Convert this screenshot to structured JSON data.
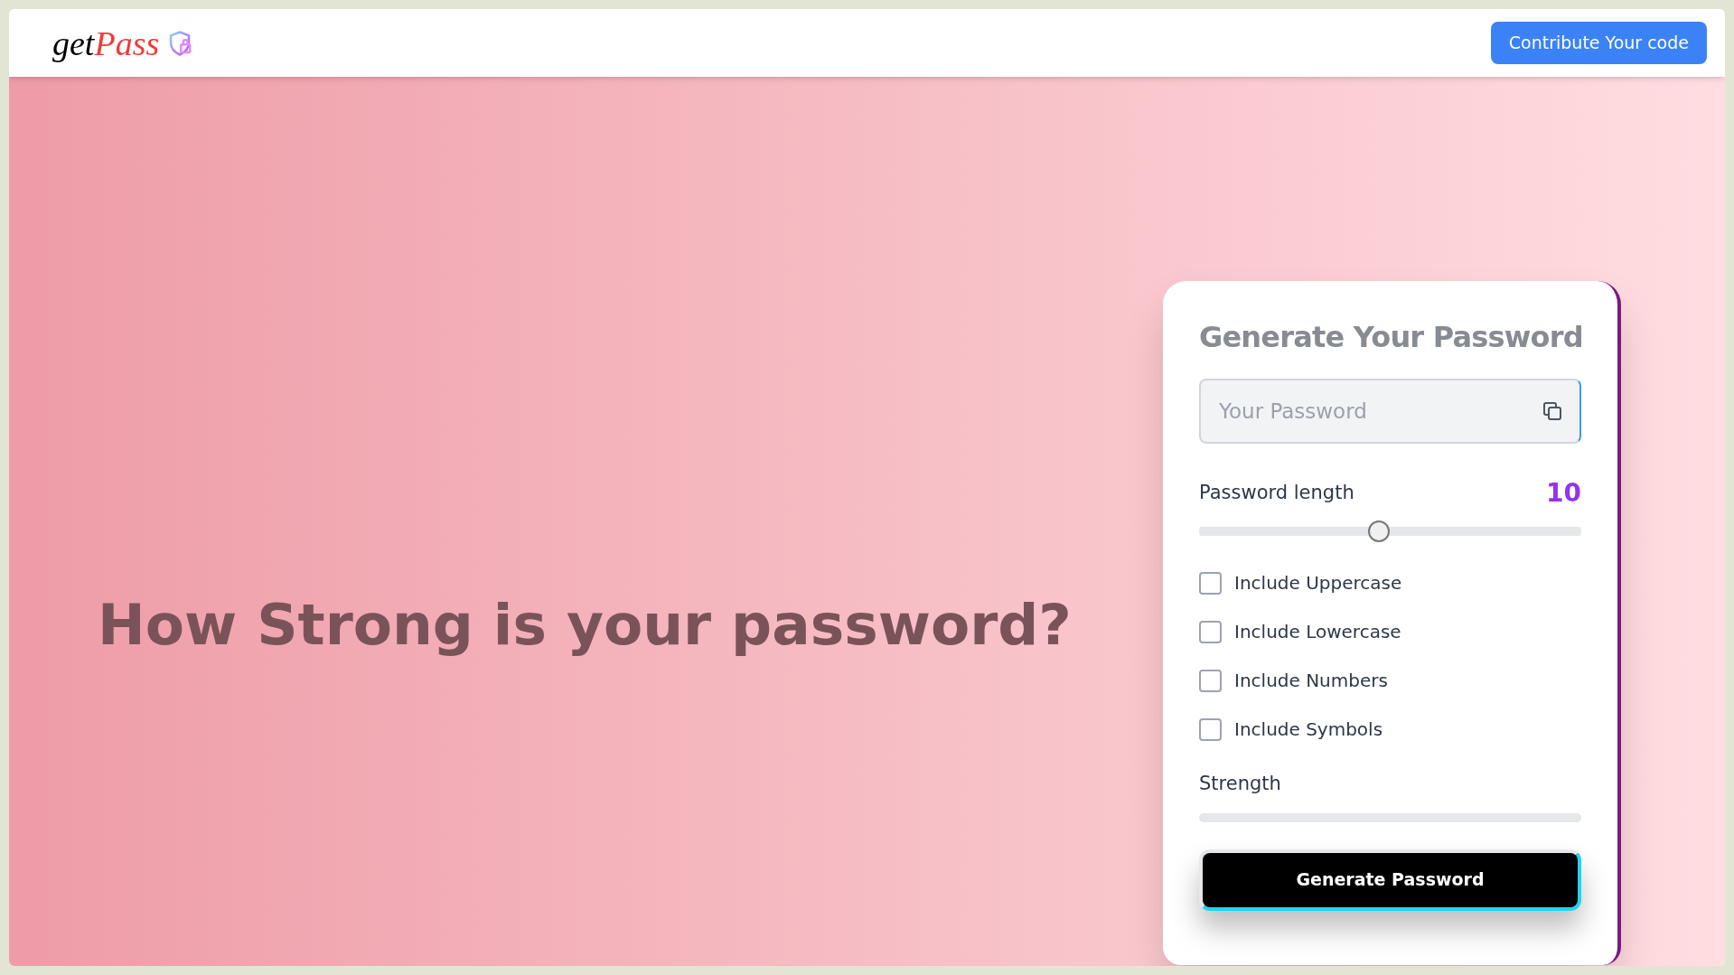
{
  "navbar": {
    "logo": {
      "prefix": "get",
      "suffix": "Pass"
    },
    "button": "Contribute Your code"
  },
  "hero": {
    "headline": "How Strong is your password?"
  },
  "generator": {
    "title": "Generate Your Password",
    "password_field": {
      "placeholder": "Your Password"
    },
    "length": {
      "label": "Password length",
      "value": "10",
      "level": 0.47
    },
    "options": [
      {
        "label": "Include Uppercase",
        "checked": false
      },
      {
        "label": "Include Lowercase",
        "checked": false
      },
      {
        "label": "Include Numbers",
        "checked": false
      },
      {
        "label": "Include Symbols",
        "checked": false
      }
    ],
    "strength": {
      "label": "Strength",
      "level": 0
    },
    "button": "Generate Password"
  }
}
